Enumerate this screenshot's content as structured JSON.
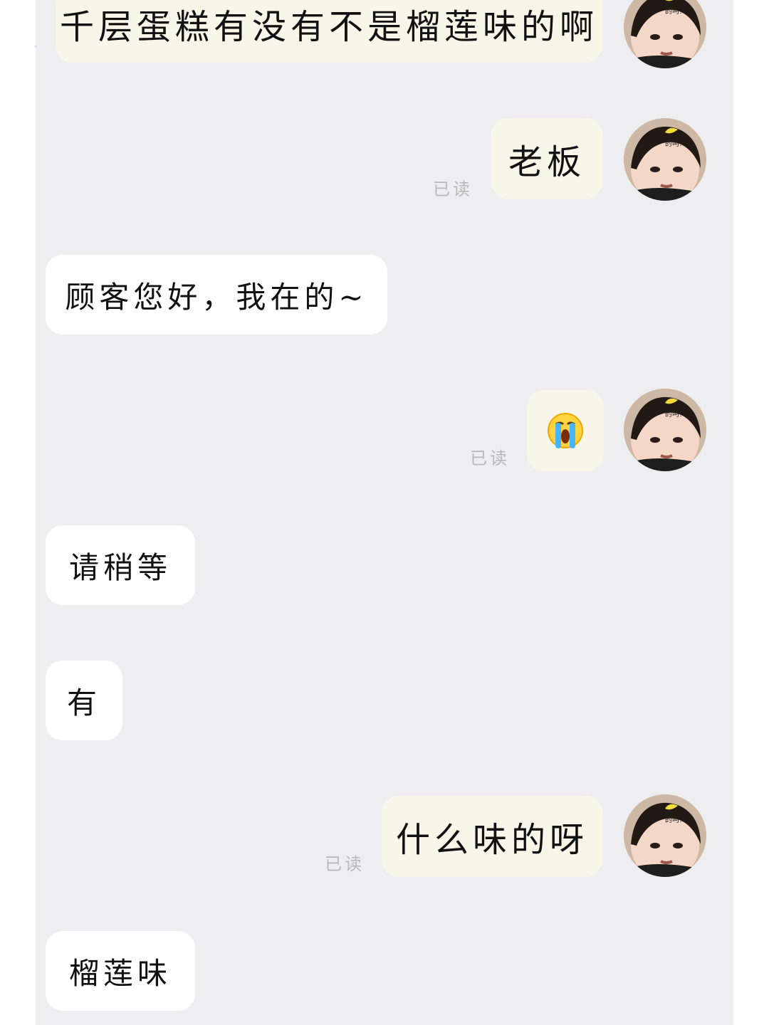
{
  "edge_mark": "ˇ",
  "messages": [
    {
      "id": "m1",
      "sender": "customer",
      "text": "千层蛋糕有没有不是榴莲味的啊",
      "read": ""
    },
    {
      "id": "m2",
      "sender": "customer",
      "text": "老板",
      "read": "已读"
    },
    {
      "id": "m3",
      "sender": "shop",
      "text": "顾客您好，我在的~"
    },
    {
      "id": "m4",
      "sender": "customer",
      "emoji": "crying-face-icon",
      "read": "已读"
    },
    {
      "id": "m5",
      "sender": "shop",
      "text": "请稍等"
    },
    {
      "id": "m6",
      "sender": "shop",
      "text": "有"
    },
    {
      "id": "m7",
      "sender": "customer",
      "text": "什么味的呀",
      "read": "已读"
    },
    {
      "id": "m8",
      "sender": "shop",
      "text": "榴莲味"
    }
  ],
  "avatar": {
    "caption": "的呵!",
    "icon": "child-avatar-icon"
  },
  "colors": {
    "outgoing_bubble": "#f7f6e8",
    "incoming_bubble": "#ffffff",
    "chat_background": "#eeeef0",
    "read_label": "#b8b8b8"
  }
}
